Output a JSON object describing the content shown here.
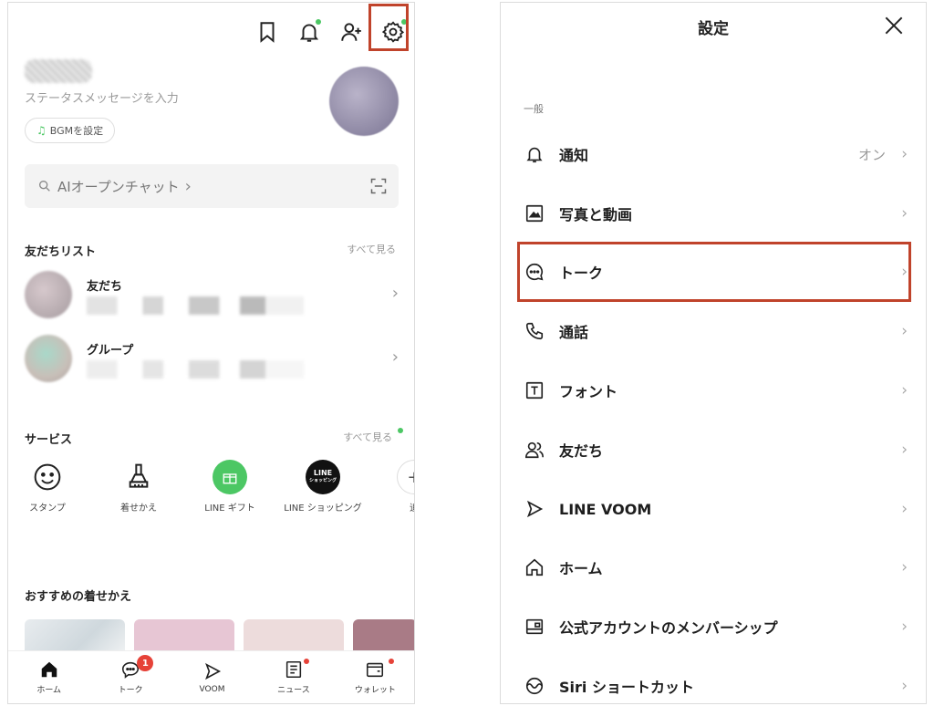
{
  "home": {
    "status_message": "ステータスメッセージを入力",
    "bgm_button": "BGMを設定",
    "search": {
      "label": "AIオープンチャット",
      "arrow": "›"
    },
    "friends_section": {
      "title": "友だちリスト",
      "see_all": "すべて見る"
    },
    "friend_rows": [
      {
        "name": "友だち",
        "chevron": "›"
      },
      {
        "name": "グループ",
        "chevron": "›"
      }
    ],
    "services_section": {
      "title": "サービス",
      "see_all": "すべて見る"
    },
    "services": [
      {
        "label": "スタンプ",
        "icon": "smile-icon"
      },
      {
        "label": "着せかえ",
        "icon": "brush-icon"
      },
      {
        "label": "LINE ギフト",
        "icon": "gift-icon"
      },
      {
        "label": "LINE ショッピング",
        "icon": "shopping-icon",
        "logo_text": "LINE",
        "logo_sub": "ショッピング"
      },
      {
        "label": "追",
        "icon": "add-icon"
      }
    ],
    "recommended": {
      "title": "おすすめの着せかえ"
    },
    "nav": [
      {
        "label": "ホーム",
        "icon": "home-icon"
      },
      {
        "label": "トーク",
        "icon": "chat-icon",
        "badge": "1"
      },
      {
        "label": "VOOM",
        "icon": "voom-icon"
      },
      {
        "label": "ニュース",
        "icon": "news-icon"
      },
      {
        "label": "ウォレット",
        "icon": "wallet-icon"
      }
    ],
    "colors": {
      "brand_green": "#4cc764",
      "badge_red": "#e64238",
      "highlight": "#c0432b"
    }
  },
  "settings": {
    "title": "設定",
    "group_label": "一般",
    "rows": [
      {
        "label": "通知",
        "value": "オン",
        "icon": "bell-icon"
      },
      {
        "label": "写真と動画",
        "value": "",
        "icon": "photo-icon"
      },
      {
        "label": "トーク",
        "value": "",
        "icon": "chat-bubble-icon"
      },
      {
        "label": "通話",
        "value": "",
        "icon": "phone-icon"
      },
      {
        "label": "フォント",
        "value": "",
        "icon": "font-icon"
      },
      {
        "label": "友だち",
        "value": "",
        "icon": "people-icon"
      },
      {
        "label": "LINE VOOM",
        "value": "",
        "icon": "voom-icon"
      },
      {
        "label": "ホーム",
        "value": "",
        "icon": "home-icon"
      },
      {
        "label": "公式アカウントのメンバーシップ",
        "value": "",
        "icon": "membership-icon"
      },
      {
        "label": "Siri ショートカット",
        "value": "",
        "icon": "siri-icon"
      }
    ],
    "chevron": "›"
  }
}
